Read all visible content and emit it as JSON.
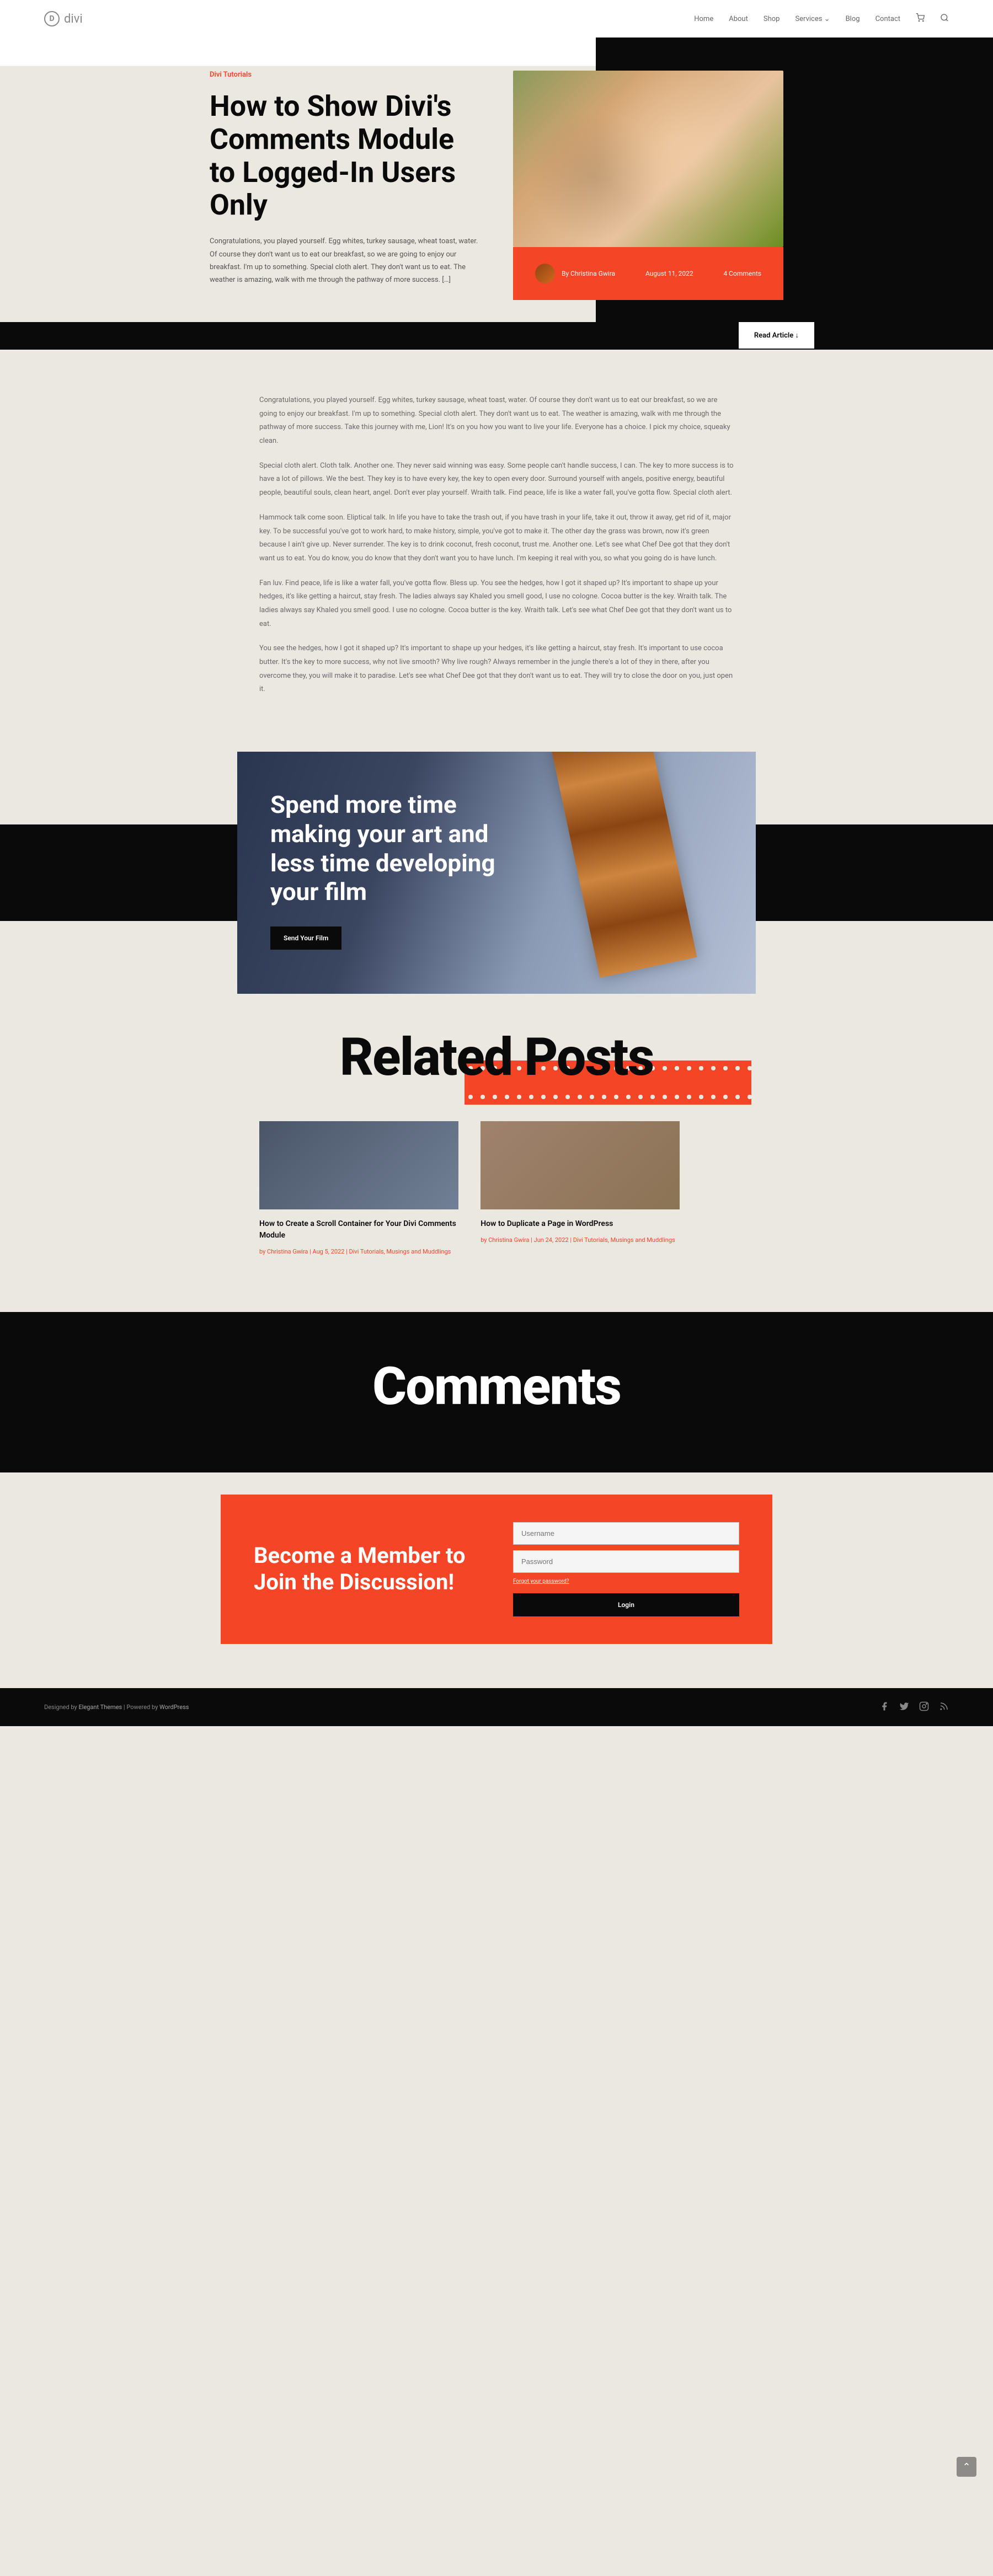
{
  "nav": {
    "logo_text": "divi",
    "items": [
      "Home",
      "About",
      "Shop",
      "Services",
      "Blog",
      "Contact"
    ]
  },
  "hero": {
    "category": "Divi Tutorials",
    "title": "How to Show Divi's Comments Module to Logged-In Users Only",
    "excerpt": "Congratulations, you played yourself. Egg whites, turkey sausage, wheat toast, water. Of course they don't want us to eat our breakfast, so we are going to enjoy our breakfast. I'm up to something. Special cloth alert. They don't want us to eat. The weather is amazing, walk with me through the pathway of more success. […]",
    "author_prefix": "By",
    "author": "Christina Gwira",
    "date": "August 11, 2022",
    "comments": "4 Comments",
    "read_article": "Read Article ↓"
  },
  "body": {
    "p1": "Congratulations, you played yourself. Egg whites, turkey sausage, wheat toast, water. Of course they don't want us to eat our breakfast, so we are going to enjoy our breakfast. I'm up to something. Special cloth alert. They don't want us to eat. The weather is amazing, walk with me through the pathway of more success. Take this journey with me, Lion! It's on you how you want to live your life. Everyone has a choice. I pick my choice, squeaky clean.",
    "p2": "Special cloth alert. Cloth talk. Another one. They never said winning was easy. Some people can't handle success, I can. The key to more success is to have a lot of pillows. We the best. They key is to have every key, the key to open every door. Surround yourself with angels, positive energy, beautiful people, beautiful souls, clean heart, angel. Don't ever play yourself. Wraith talk. Find peace, life is like a water fall, you've gotta flow. Special cloth alert.",
    "p3": "Hammock talk come soon. Eliptical talk. In life you have to take the trash out, if you have trash in your life, take it out, throw it away, get rid of it, major key. To be successful you've got to work hard, to make history, simple, you've got to make it. The other day the grass was brown, now it's green because I ain't give up. Never surrender. The key is to drink coconut, fresh coconut, trust me. Another one. Let's see what Chef Dee got that they don't want us to eat. You do know, you do know that they don't want you to have lunch. I'm keeping it real with you, so what you going do is have lunch.",
    "p4": "Fan luv. Find peace, life is like a water fall, you've gotta flow. Bless up. You see the hedges, how I got it shaped up? It's important to shape up your hedges, it's like getting a haircut, stay fresh. The ladies always say Khaled you smell good, I use no cologne. Cocoa butter is the key. Wraith talk. The ladies always say Khaled you smell good. I use no cologne. Cocoa butter is the key. Wraith talk. Let's see what Chef Dee got that they don't want us to eat.",
    "p5": "You see the hedges, how I got it shaped up? It's important to shape up your hedges, it's like getting a haircut, stay fresh. It's important to use cocoa butter. It's the key to more success, why not live smooth? Why live rough? Always remember in the jungle there's a lot of they in there, after you overcome they, you will make it to paradise. Let's see what Chef Dee got that they don't want us to eat. They will try to close the door on you, just open it."
  },
  "cta": {
    "title": "Spend more time making your art and less time developing your film",
    "button": "Send Your Film"
  },
  "related": {
    "heading": "Related Posts",
    "posts": [
      {
        "title": "How to Create a Scroll Container for Your Divi Comments Module",
        "meta": "by Christina Gwira | Aug 5, 2022 | Divi Tutorials, Musings and Muddlings"
      },
      {
        "title": "How to Duplicate a Page in WordPress",
        "meta": "by Christina Gwira | Jun 24, 2022 | Divi Tutorials, Musings and Muddlings"
      }
    ]
  },
  "comments": {
    "heading": "Comments"
  },
  "member": {
    "title": "Become a Member to Join the Discussion!",
    "username_ph": "Username",
    "password_ph": "Password",
    "forgot": "Forgot your password?",
    "login": "Login"
  },
  "footer": {
    "text_pre": "Designed by ",
    "brand1": "Elegant Themes",
    "text_mid": " | Powered by ",
    "brand2": "WordPress"
  }
}
